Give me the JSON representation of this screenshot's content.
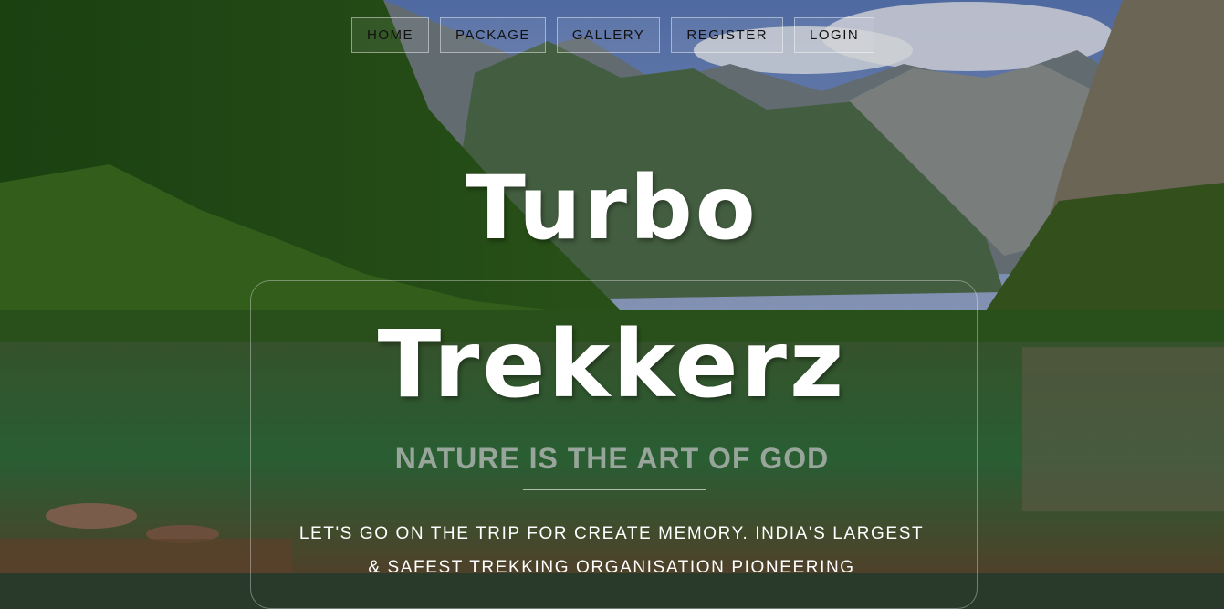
{
  "nav": {
    "items": [
      {
        "label": "HOME"
      },
      {
        "label": "PACKAGE"
      },
      {
        "label": "GALLERY"
      },
      {
        "label": "REGISTER"
      },
      {
        "label": "LOGIN"
      }
    ]
  },
  "hero": {
    "title_line1": "Turbo",
    "title_line2": "Trekkerz",
    "tagline": "NATURE IS THE ART OF GOD",
    "description": "LET'S GO ON THE TRIP FOR CREATE MEMORY. INDIA'S LARGEST & SAFEST TREKKING ORGANISATION PIONEERING"
  },
  "colors": {
    "nav_text": "#111111",
    "title": "#ffffff",
    "tagline": "#bebebe"
  }
}
